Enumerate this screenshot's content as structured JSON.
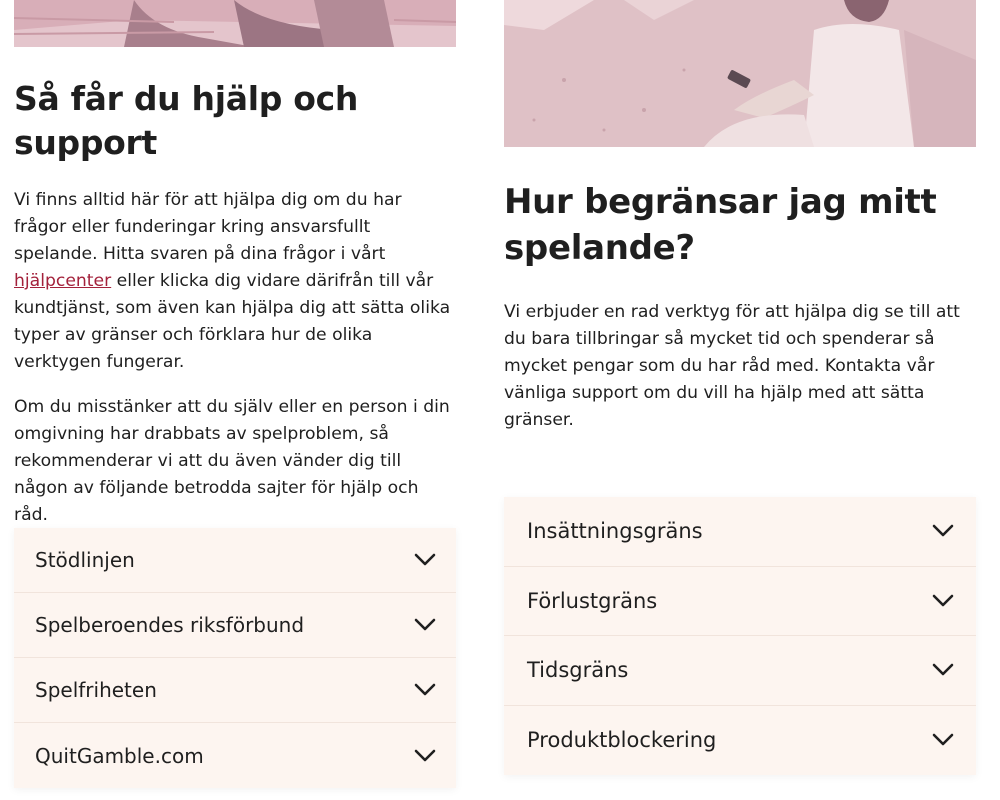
{
  "left": {
    "title": "Så får du hjälp och support",
    "p1_before": "Vi finns alltid här för att hjälpa dig om du har frågor eller funderingar kring ansvarsfullt spelande. Hitta svaren på dina frågor i vårt ",
    "p1_link": "hjälpcenter",
    "p1_after": " eller klicka dig vidare därifrån till vår kundtjänst, som även kan hjälpa dig att sätta olika typer av gränser och förklara hur de olika verktygen fungerar.",
    "p2": "Om du misstänker att du själv eller en person i din omgivning har drabbats av spelproblem, så rekommenderar vi att du även vänder dig till någon av följande betrodda sajter för hjälp och råd.",
    "accordion": [
      {
        "label": "Stödlinjen"
      },
      {
        "label": "Spelberoendes riksförbund"
      },
      {
        "label": "Spelfriheten"
      },
      {
        "label": "QuitGamble.com"
      }
    ]
  },
  "right": {
    "title": "Hur begränsar jag mitt spelande?",
    "p1": "Vi erbjuder en rad verktyg för att hjälpa dig se till att du bara tillbringar så mycket tid och spenderar så mycket pengar som du har råd med. Kontakta vår vänliga support om du vill ha hjälp med att sätta gränser.",
    "accordion": [
      {
        "label": "Insättningsgräns"
      },
      {
        "label": "Förlustgräns"
      },
      {
        "label": "Tidsgräns"
      },
      {
        "label": "Produktblockering"
      }
    ]
  },
  "icons": {
    "accordion_toggle": "chevron-down-icon"
  },
  "colors": {
    "link": "#a3213b",
    "accordion_bg": "#fdf5f0",
    "text": "#1f1f1f"
  }
}
